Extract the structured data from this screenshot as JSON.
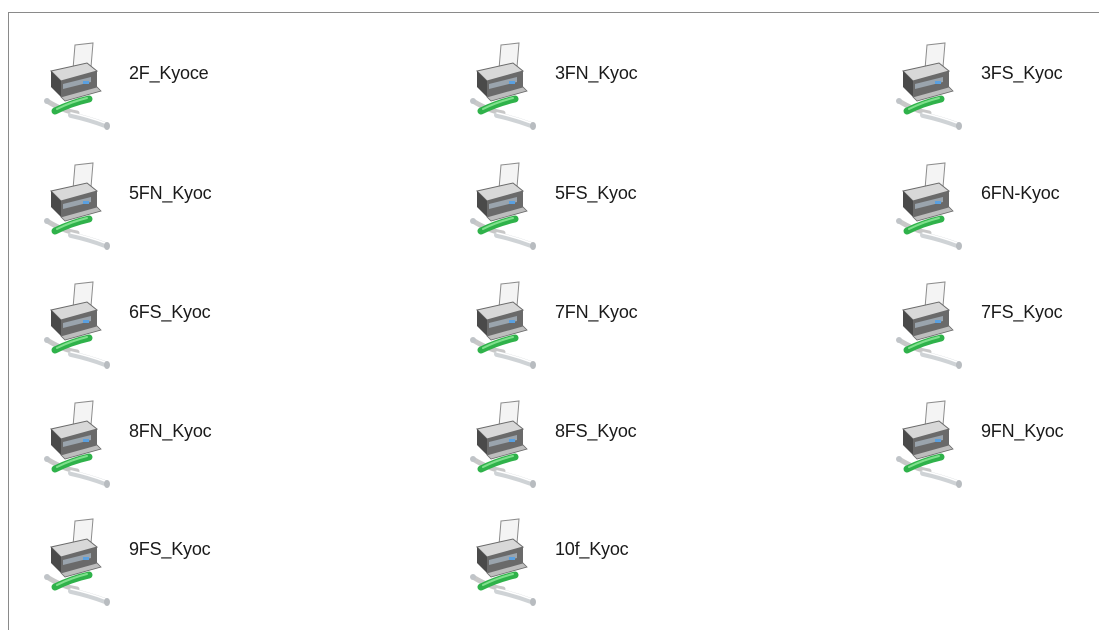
{
  "printers": [
    {
      "label": "2F_Kyoce",
      "icon": "network-printer-icon"
    },
    {
      "label": "3FN_Kyoc",
      "icon": "network-printer-icon"
    },
    {
      "label": "3FS_Kyoc",
      "icon": "network-printer-icon"
    },
    {
      "label": "5FN_Kyoc",
      "icon": "network-printer-icon"
    },
    {
      "label": "5FS_Kyoc",
      "icon": "network-printer-icon"
    },
    {
      "label": "6FN-Kyoc",
      "icon": "network-printer-icon"
    },
    {
      "label": "6FS_Kyoc",
      "icon": "network-printer-icon"
    },
    {
      "label": "7FN_Kyoc",
      "icon": "network-printer-icon"
    },
    {
      "label": "7FS_Kyoc",
      "icon": "network-printer-icon"
    },
    {
      "label": "8FN_Kyoc",
      "icon": "network-printer-icon"
    },
    {
      "label": "8FS_Kyoc",
      "icon": "network-printer-icon"
    },
    {
      "label": "9FN_Kyoc",
      "icon": "network-printer-icon"
    },
    {
      "label": "9FS_Kyoc",
      "icon": "network-printer-icon"
    },
    {
      "label": "10f_Kyoc",
      "icon": "network-printer-icon"
    }
  ],
  "colors": {
    "cable_green": "#2fb24a",
    "printer_dark": "#4a4a4a",
    "paper": "#f4f4f4",
    "frame_border": "#8a8a8a"
  }
}
